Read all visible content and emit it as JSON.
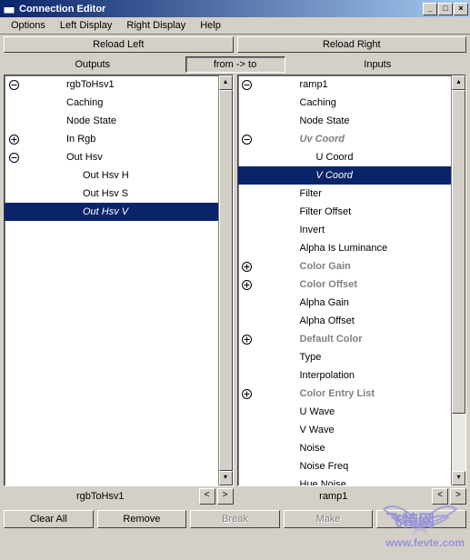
{
  "window": {
    "title": "Connection Editor",
    "min_label": "_",
    "max_label": "□",
    "close_label": "×"
  },
  "menu": {
    "options": "Options",
    "left_display": "Left Display",
    "right_display": "Right Display",
    "help": "Help"
  },
  "toolbar": {
    "reload_left": "Reload Left",
    "reload_right": "Reload Right",
    "outputs": "Outputs",
    "from_to": "from -> to",
    "inputs": "Inputs"
  },
  "left_tree": {
    "root": "rgbToHsv1",
    "items": [
      {
        "label": "Caching",
        "indent": 1
      },
      {
        "label": "Node State",
        "indent": 1
      },
      {
        "label": "In Rgb",
        "indent": 1,
        "expander": "plus"
      },
      {
        "label": "Out Hsv",
        "indent": 1,
        "expander": "minus"
      },
      {
        "label": "Out Hsv H",
        "indent": 2
      },
      {
        "label": "Out Hsv S",
        "indent": 2
      },
      {
        "label": "Out Hsv V",
        "indent": 2,
        "selected": true
      }
    ]
  },
  "right_tree": {
    "root": "ramp1",
    "items": [
      {
        "label": "Caching",
        "indent": 1
      },
      {
        "label": "Node State",
        "indent": 1
      },
      {
        "label": "Uv Coord",
        "indent": 1,
        "expander": "minus",
        "grey_italic": true
      },
      {
        "label": "U Coord",
        "indent": 2
      },
      {
        "label": "V Coord",
        "indent": 2,
        "selected": true
      },
      {
        "label": "Filter",
        "indent": 1
      },
      {
        "label": "Filter Offset",
        "indent": 1
      },
      {
        "label": "Invert",
        "indent": 1
      },
      {
        "label": "Alpha Is Luminance",
        "indent": 1
      },
      {
        "label": "Color Gain",
        "indent": 1,
        "expander": "plus",
        "grey": true
      },
      {
        "label": "Color Offset",
        "indent": 1,
        "expander": "plus",
        "grey": true
      },
      {
        "label": "Alpha Gain",
        "indent": 1
      },
      {
        "label": "Alpha Offset",
        "indent": 1
      },
      {
        "label": "Default Color",
        "indent": 1,
        "expander": "plus",
        "grey": true
      },
      {
        "label": "Type",
        "indent": 1
      },
      {
        "label": "Interpolation",
        "indent": 1
      },
      {
        "label": "Color Entry List",
        "indent": 1,
        "expander": "plus",
        "grey": true
      },
      {
        "label": "U Wave",
        "indent": 1
      },
      {
        "label": "V Wave",
        "indent": 1
      },
      {
        "label": "Noise",
        "indent": 1
      },
      {
        "label": "Noise Freq",
        "indent": 1
      },
      {
        "label": "Hue Noise",
        "indent": 1
      }
    ]
  },
  "footer": {
    "left_name": "rgbToHsv1",
    "right_name": "ramp1",
    "prev": "<",
    "next": ">"
  },
  "buttons": {
    "clear_all": "Clear All",
    "remove": "Remove",
    "break": "Break",
    "make": "Make",
    "close": "Close"
  },
  "watermark": "飞特网\nwww.fevte.com"
}
